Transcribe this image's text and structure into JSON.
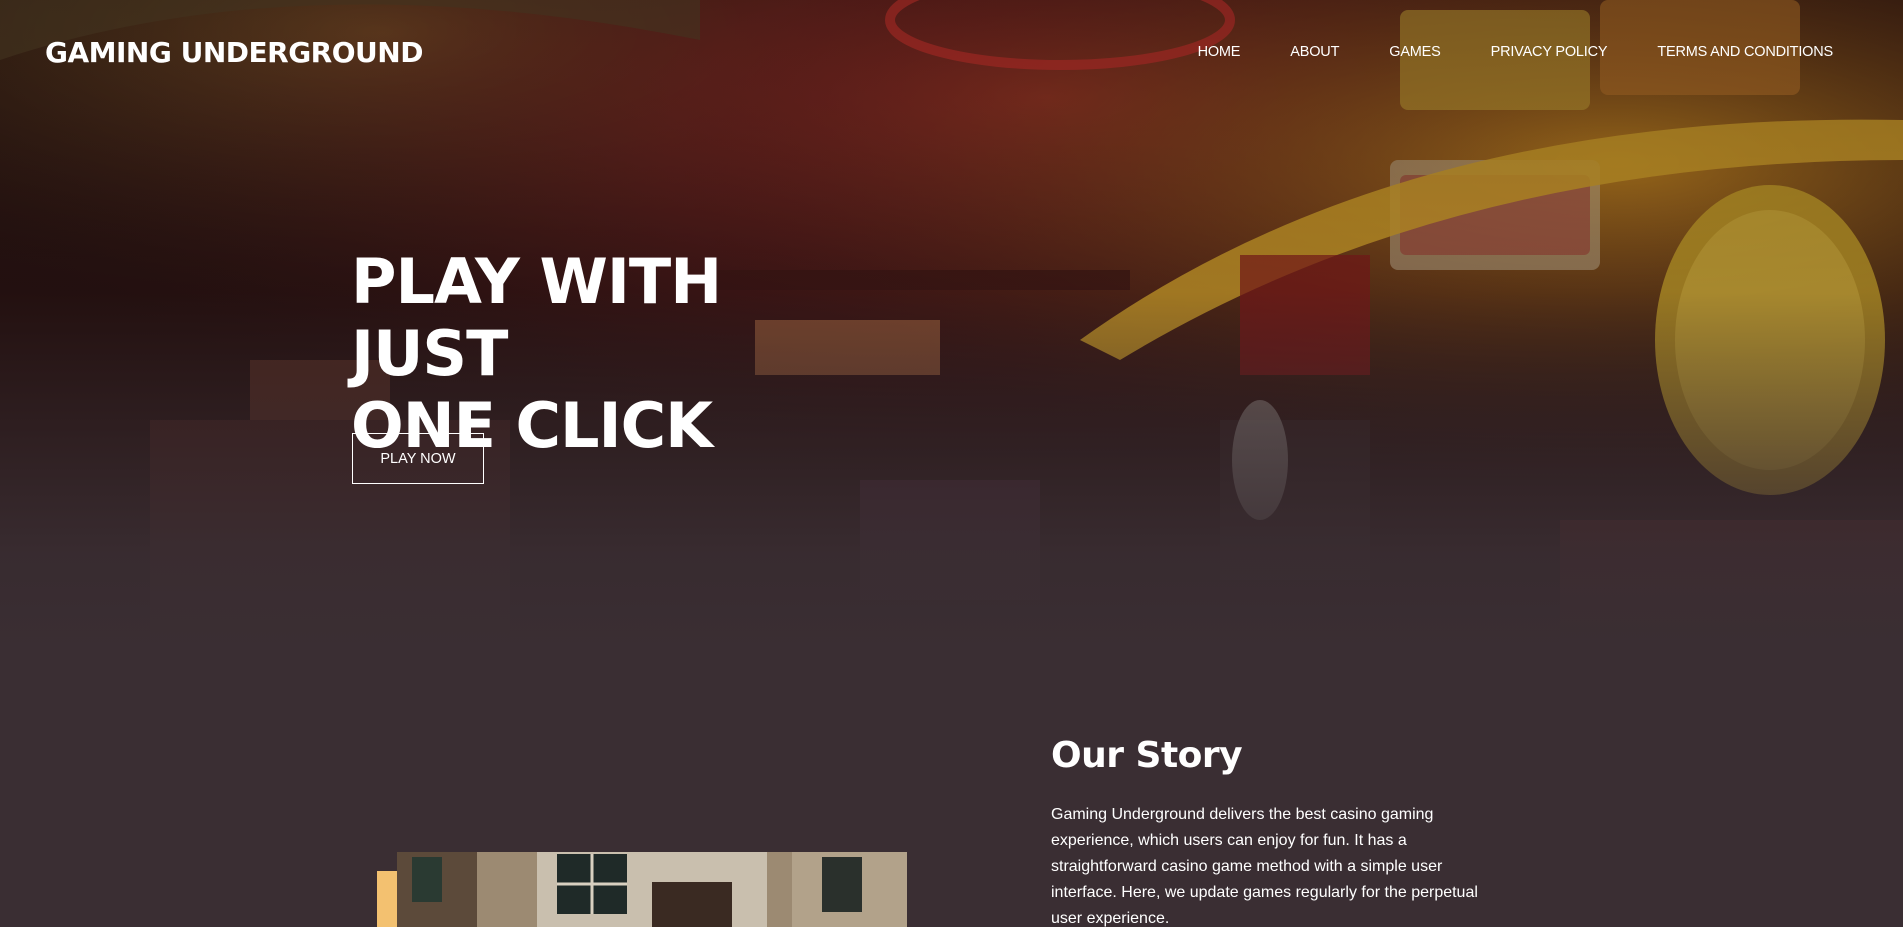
{
  "header": {
    "logo": "GAMING UNDERGROUND",
    "nav": [
      "HOME",
      "ABOUT",
      "GAMES",
      "PRIVACY POLICY",
      "TERMS AND CONDITIONS"
    ]
  },
  "hero": {
    "title_line1": "PLAY WITH JUST",
    "title_line2": "ONE CLICK",
    "button_label": "PLAY NOW",
    "background_icon": "arcade-bar-photo"
  },
  "story": {
    "title": "Our Story",
    "text": "Gaming Underground delivers the best casino gaming experience, which users can enjoy for fun. It has a straightforward casino game method with a simple user interface. Here, we update games regularly for the perpetual user experience.",
    "photo_icon": "building-photo",
    "accent_color": "#f3c170"
  },
  "colors": {
    "background": "#3a2e33",
    "text": "#ffffff"
  }
}
